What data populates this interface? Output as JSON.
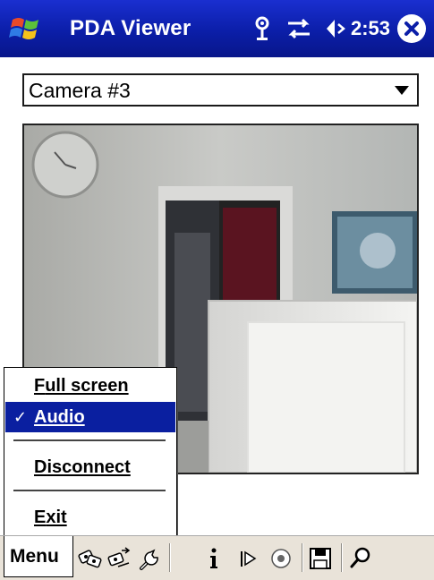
{
  "title_bar": {
    "app_title": "PDA Viewer",
    "time": "2:53",
    "icons": [
      "windows-start-icon",
      "antenna-icon",
      "sync-icon",
      "volume-icon",
      "close-icon"
    ]
  },
  "camera_select": {
    "selected": "Camera #3",
    "icon": "chevron-down-icon"
  },
  "menu": {
    "items": [
      {
        "underline": "F",
        "rest": "ull screen",
        "checked": false,
        "selected": false
      },
      {
        "underline": "A",
        "rest": "udio",
        "checked": true,
        "selected": true
      },
      {
        "underline": "D",
        "rest": "isconnect",
        "checked": false,
        "selected": false
      },
      {
        "underline": "E",
        "rest": "xit",
        "checked": false,
        "selected": false
      }
    ],
    "check_mark": "✓"
  },
  "toolbar": {
    "menu_label": "Menu",
    "icons": [
      "cameras-icon",
      "connect-icon",
      "settings-icon",
      "info-icon",
      "ptz-icon",
      "record-icon",
      "save-icon",
      "zoom-icon"
    ]
  },
  "colors": {
    "titlebar": "#0b1ea8",
    "menu_highlight": "#0a1fa0",
    "toolbar": "#e9e3d9"
  }
}
